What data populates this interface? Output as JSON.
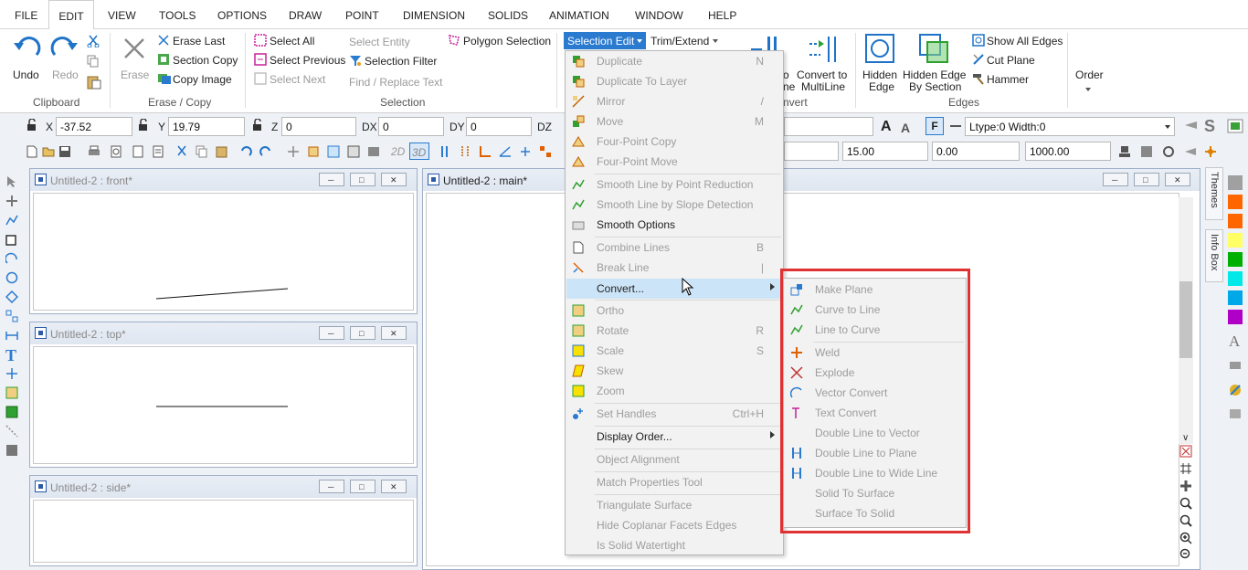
{
  "menubar": {
    "items": [
      "FILE",
      "EDIT",
      "VIEW",
      "TOOLS",
      "OPTIONS",
      "DRAW",
      "POINT",
      "DIMENSION",
      "SOLIDS",
      "ANIMATION",
      "WINDOW",
      "HELP"
    ],
    "active": "EDIT"
  },
  "ribbon": {
    "undo": "Undo",
    "redo": "Redo",
    "clipboard_label": "Clipboard",
    "erase": "Erase",
    "erase_last": "Erase Last",
    "section_copy": "Section Copy",
    "copy_image": "Copy Image",
    "erase_copy_label": "Erase / Copy",
    "select_all": "Select All",
    "select_previous": "Select Previous",
    "select_next": "Select Next",
    "select_entity": "Select Entity",
    "selection_filter": "Selection Filter",
    "find_replace": "Find / Replace Text",
    "polygon_selection": "Polygon Selection",
    "selection_label": "Selection",
    "selection_edit": "Selection Edit",
    "trim_extend": "Trim/Extend",
    "convert_partial_1": "o",
    "convert_partial_2": "ne",
    "convert_label_partial": "nvert",
    "convert_multiline_1": "Convert to",
    "convert_multiline_2": "MultiLine",
    "hidden_edge_1": "Hidden",
    "hidden_edge_2": "Edge",
    "hidden_edge_section_1": "Hidden Edge",
    "hidden_edge_section_2": "By Section",
    "show_all_edges": "Show All Edges",
    "cut_plane": "Cut Plane",
    "hammer": "Hammer",
    "edges_label": "Edges",
    "order": "Order"
  },
  "coords": {
    "x_label": "X",
    "x": "-37.52",
    "y_label": "Y",
    "y": "19.79",
    "z_label": "Z",
    "z": "0",
    "dx_label": "DX",
    "dx": "0",
    "dy_label": "DY",
    "dy": "0",
    "dz_label": "DZ",
    "ltype": "Ltype:0  Width:0"
  },
  "toolbar2": {
    "btn_2d": "2D",
    "btn_3d": "3D",
    "val1": "15.00",
    "val2": "0.00",
    "val3": "1000.00"
  },
  "windows": {
    "front": "Untitled-2 : front*",
    "top": "Untitled-2 : top*",
    "side": "Untitled-2 : side*",
    "main": "Untitled-2 : main*"
  },
  "side_tabs": {
    "themes": "Themes",
    "info_box": "Info Box"
  },
  "palette": [
    "#a0a0a0",
    "#ff6600",
    "#ff6600",
    "#ffff66",
    "#00b000",
    "#00e8e8",
    "#00a8e8",
    "#b000c8"
  ],
  "edit_menu": [
    {
      "label": "Duplicate",
      "key": "N",
      "disabled": true
    },
    {
      "label": "Duplicate To Layer",
      "key": "",
      "disabled": true
    },
    {
      "label": "Mirror",
      "key": "/",
      "disabled": true
    },
    {
      "label": "Move",
      "key": "M",
      "disabled": true
    },
    {
      "label": "Four-Point Copy",
      "key": "",
      "disabled": true
    },
    {
      "label": "Four-Point Move",
      "key": "",
      "disabled": true
    },
    {
      "label": "Smooth Line by Point Reduction",
      "key": "",
      "disabled": true
    },
    {
      "label": "Smooth Line by Slope Detection",
      "key": "",
      "disabled": true
    },
    {
      "label": "Smooth Options",
      "key": "",
      "disabled": false
    },
    {
      "label": "Combine Lines",
      "key": "B",
      "disabled": true
    },
    {
      "label": "Break Line",
      "key": "|",
      "disabled": true
    },
    {
      "label": "Convert...",
      "key": "",
      "disabled": false
    },
    {
      "label": "Ortho",
      "key": "",
      "disabled": true
    },
    {
      "label": "Rotate",
      "key": "R",
      "disabled": true
    },
    {
      "label": "Scale",
      "key": "S",
      "disabled": true
    },
    {
      "label": "Skew",
      "key": "",
      "disabled": true
    },
    {
      "label": "Zoom",
      "key": "",
      "disabled": true
    },
    {
      "label": "Set Handles",
      "key": "Ctrl+H",
      "disabled": true
    },
    {
      "label": "Display Order...",
      "key": "",
      "disabled": false
    },
    {
      "label": "Object Alignment",
      "key": "",
      "disabled": true
    },
    {
      "label": "Match Properties Tool",
      "key": "",
      "disabled": true
    },
    {
      "label": "Triangulate Surface",
      "key": "",
      "disabled": true
    },
    {
      "label": "Hide Coplanar Facets Edges",
      "key": "",
      "disabled": true
    },
    {
      "label": "Is Solid Watertight",
      "key": "",
      "disabled": true
    }
  ],
  "convert_menu": [
    {
      "label": "Make Plane"
    },
    {
      "label": "Curve to Line"
    },
    {
      "label": "Line to Curve"
    },
    {
      "label": "Weld"
    },
    {
      "label": "Explode"
    },
    {
      "label": "Vector Convert"
    },
    {
      "label": "Text Convert"
    },
    {
      "label": "Double Line to Vector"
    },
    {
      "label": "Double Line to Plane"
    },
    {
      "label": "Double Line to Wide Line"
    },
    {
      "label": "Solid To Surface"
    },
    {
      "label": "Surface To Solid"
    }
  ]
}
